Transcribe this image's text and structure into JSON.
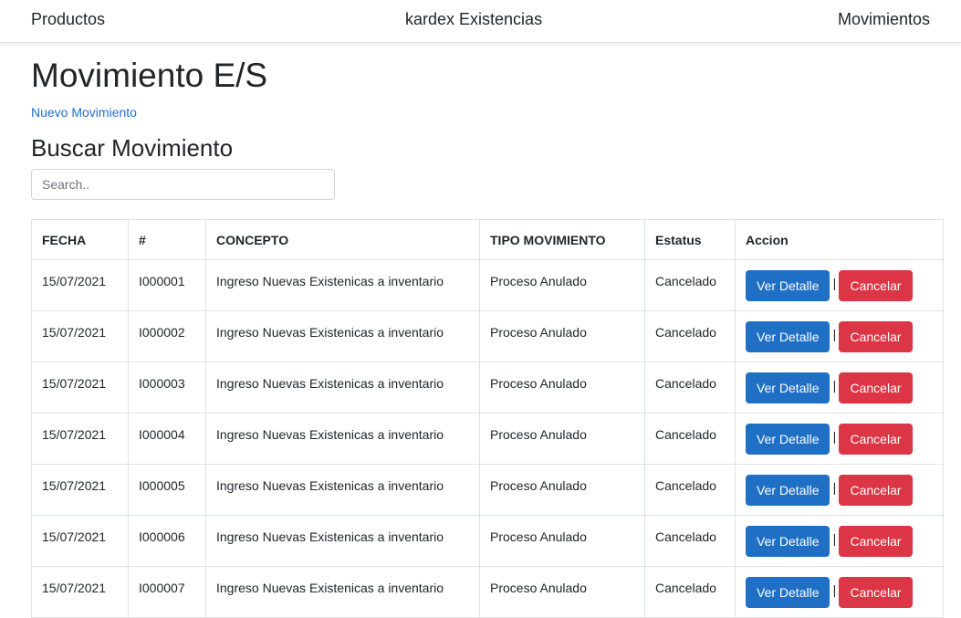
{
  "nav": {
    "left": "Productos",
    "center": "kardex Existencias",
    "right": "Movimientos"
  },
  "page": {
    "title": "Movimiento E/S",
    "new_link": "Nuevo Movimiento",
    "search_title": "Buscar Movimiento",
    "search_placeholder": "Search.."
  },
  "table": {
    "headers": [
      "FECHA",
      "#",
      "CONCEPTO",
      "TIPO MOVIMIENTO",
      "Estatus",
      "Accion"
    ],
    "detail_label": "Ver Detalle",
    "separator": "|",
    "cancel_label": "Cancelar",
    "rows": [
      {
        "fecha": "15/07/2021",
        "num": "I000001",
        "concepto": "Ingreso Nuevas Existenicas a inventario",
        "tipo": "Proceso Anulado",
        "estatus": "Cancelado"
      },
      {
        "fecha": "15/07/2021",
        "num": "I000002",
        "concepto": "Ingreso Nuevas Existenicas a inventario",
        "tipo": "Proceso Anulado",
        "estatus": "Cancelado"
      },
      {
        "fecha": "15/07/2021",
        "num": "I000003",
        "concepto": "Ingreso Nuevas Existenicas a inventario",
        "tipo": "Proceso Anulado",
        "estatus": "Cancelado"
      },
      {
        "fecha": "15/07/2021",
        "num": "I000004",
        "concepto": "Ingreso Nuevas Existenicas a inventario",
        "tipo": "Proceso Anulado",
        "estatus": "Cancelado"
      },
      {
        "fecha": "15/07/2021",
        "num": "I000005",
        "concepto": "Ingreso Nuevas Existenicas a inventario",
        "tipo": "Proceso Anulado",
        "estatus": "Cancelado"
      },
      {
        "fecha": "15/07/2021",
        "num": "I000006",
        "concepto": "Ingreso Nuevas Existenicas a inventario",
        "tipo": "Proceso Anulado",
        "estatus": "Cancelado"
      },
      {
        "fecha": "15/07/2021",
        "num": "I000007",
        "concepto": "Ingreso Nuevas Existenicas a inventario",
        "tipo": "Proceso Anulado",
        "estatus": "Cancelado"
      }
    ]
  },
  "colors": {
    "link": "#1f6fd1",
    "primary_button": "#1f6fc5",
    "danger_button": "#dc3545"
  }
}
